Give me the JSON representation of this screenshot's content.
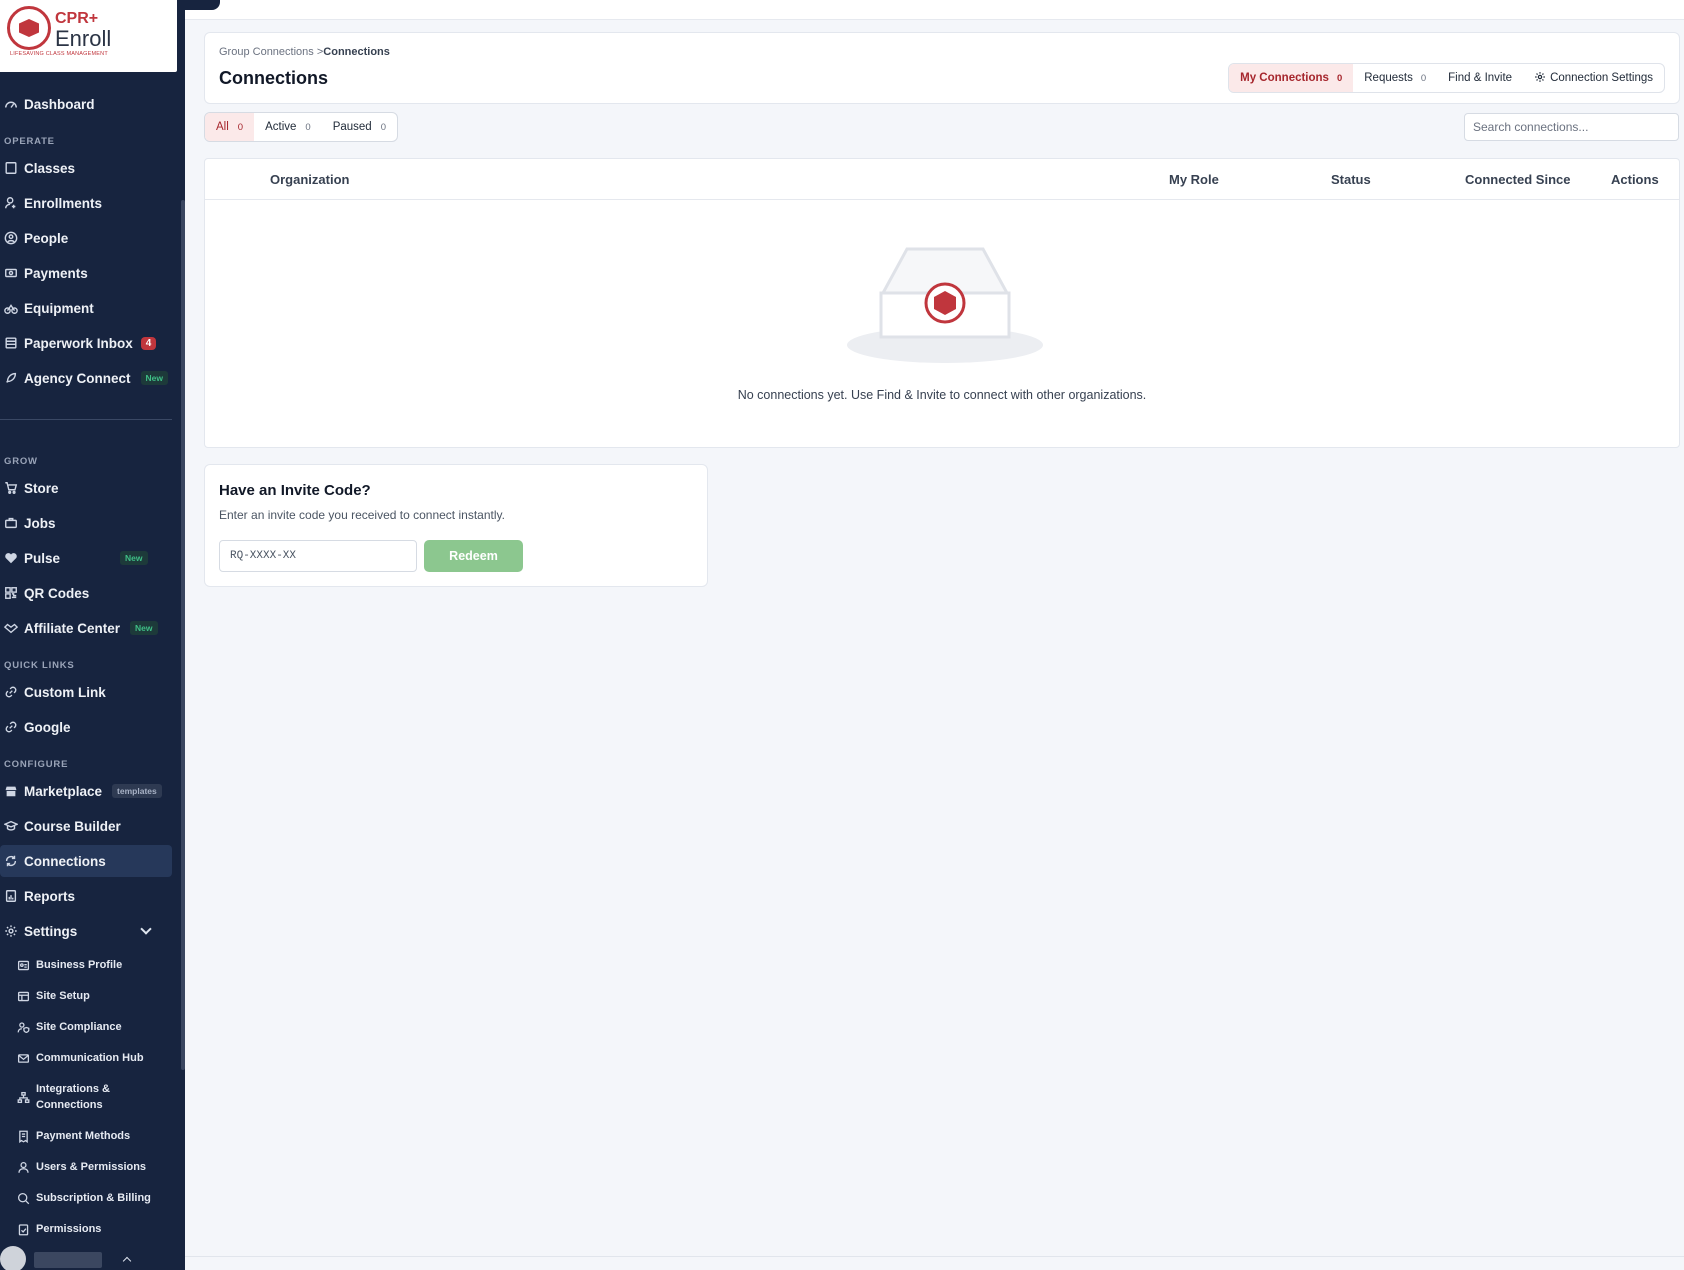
{
  "brand": {
    "name_top": "CPR+",
    "name_bottom": "Enroll",
    "tagline": "LIFESAVING CLASS MANAGEMENT",
    "accent": "#c0363d"
  },
  "sidebar": {
    "dashboard": "Dashboard",
    "sections": {
      "operate": "OPERATE",
      "grow": "GROW",
      "quick_links": "QUICK LINKS",
      "configure": "CONFIGURE"
    },
    "operate": [
      {
        "label": "Classes",
        "icon": "book-icon"
      },
      {
        "label": "Enrollments",
        "icon": "user-plus-icon"
      },
      {
        "label": "People",
        "icon": "person-circle-icon"
      },
      {
        "label": "Payments",
        "icon": "cash-icon"
      },
      {
        "label": "Equipment",
        "icon": "bicycle-icon"
      },
      {
        "label": "Paperwork Inbox",
        "icon": "inbox-icon",
        "badge": "4"
      },
      {
        "label": "Agency Connect",
        "icon": "rocket-icon",
        "badge": "New"
      }
    ],
    "grow": [
      {
        "label": "Store",
        "icon": "cart-icon"
      },
      {
        "label": "Jobs",
        "icon": "briefcase-icon"
      },
      {
        "label": "Pulse",
        "icon": "heart-pulse-icon",
        "badge": "New"
      },
      {
        "label": "QR Codes",
        "icon": "qr-code-icon"
      },
      {
        "label": "Affiliate Center",
        "icon": "handshake-icon",
        "badge": "New"
      }
    ],
    "quick_links": [
      {
        "label": "Custom Link",
        "icon": "link-icon"
      },
      {
        "label": "Google",
        "icon": "link-icon"
      }
    ],
    "configure": [
      {
        "label": "Marketplace",
        "icon": "shop-icon",
        "badge": "templates"
      },
      {
        "label": "Course Builder",
        "icon": "graduation-cap-icon"
      },
      {
        "label": "Connections",
        "icon": "sync-icon"
      },
      {
        "label": "Reports",
        "icon": "report-icon"
      },
      {
        "label": "Settings",
        "icon": "gear-icon"
      }
    ],
    "settings_sub": [
      {
        "label": "Business Profile"
      },
      {
        "label": "Site Setup"
      },
      {
        "label": "Site Compliance"
      },
      {
        "label": "Communication Hub"
      },
      {
        "label": "Integrations & Connections"
      },
      {
        "label": "Payment Methods"
      },
      {
        "label": "Users & Permissions"
      },
      {
        "label": "Subscription & Billing"
      },
      {
        "label": "Permissions"
      }
    ]
  },
  "header": {
    "breadcrumb_parent": "Group Connections",
    "breadcrumb_sep": ">",
    "breadcrumb_current": "Connections",
    "title": "Connections",
    "tabs": [
      {
        "label": "My Connections",
        "count": "0"
      },
      {
        "label": "Requests",
        "count": "0"
      },
      {
        "label": "Find & Invite"
      },
      {
        "label": "Connection Settings"
      }
    ]
  },
  "filters": [
    {
      "label": "All",
      "count": "0"
    },
    {
      "label": "Active",
      "count": "0"
    },
    {
      "label": "Paused",
      "count": "0"
    }
  ],
  "search": {
    "placeholder": "Search connections..."
  },
  "table": {
    "columns": [
      "Organization",
      "My Role",
      "Status",
      "Connected Since",
      "Actions"
    ],
    "empty_text": "No connections yet. Use Find & Invite to connect with other organizations."
  },
  "invite": {
    "title": "Have an Invite Code?",
    "subtitle": "Enter an invite code you received to connect instantly.",
    "placeholder": "RQ-XXXX-XX",
    "button": "Redeem"
  },
  "colors": {
    "sidebar_bg": "#17243f",
    "active_tab_bg": "#fbe9e9",
    "active_tab_text": "#a6262d",
    "redeem_bg": "#8cc78f"
  }
}
